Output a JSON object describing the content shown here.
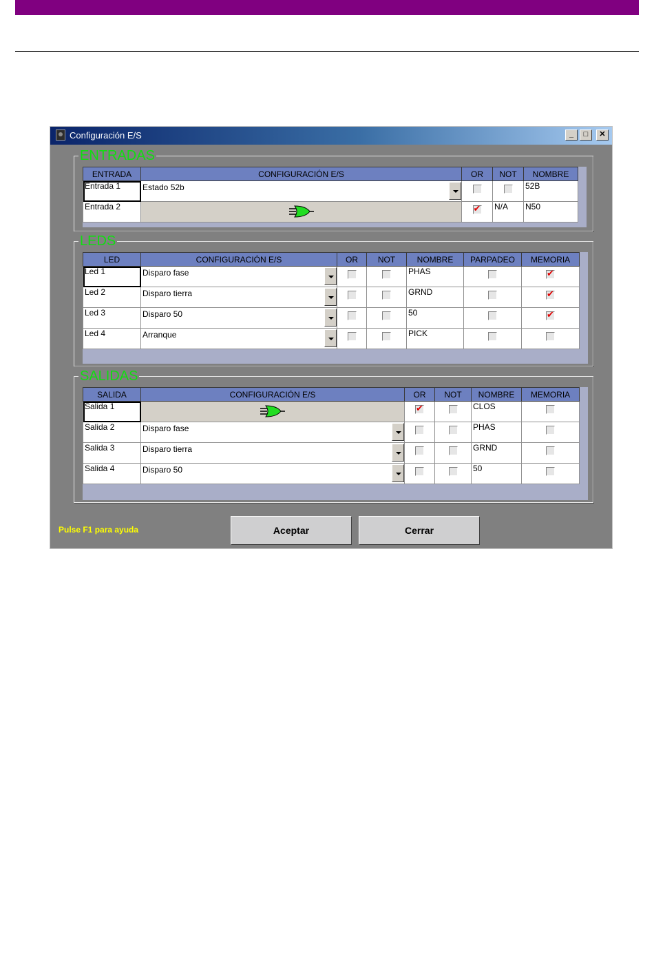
{
  "window": {
    "title": "Configuración E/S"
  },
  "entradas": {
    "legend": "ENTRADAS",
    "headers": [
      "ENTRADA",
      "CONFIGURACIÓN E/S",
      "OR",
      "NOT",
      "NOMBRE"
    ],
    "rows": [
      {
        "label": "Entrada 1",
        "config": "Estado 52b",
        "or": false,
        "not": false,
        "not_text": "",
        "name": "52B",
        "gate": false
      },
      {
        "label": "Entrada 2",
        "config": "",
        "or": true,
        "not": null,
        "not_text": "N/A",
        "name": "N50",
        "gate": true
      }
    ]
  },
  "leds": {
    "legend": "LEDS",
    "headers": [
      "LED",
      "CONFIGURACIÓN E/S",
      "OR",
      "NOT",
      "NOMBRE",
      "PARPADEO",
      "MEMORIA"
    ],
    "rows": [
      {
        "label": "Led 1",
        "config": "Disparo fase",
        "or": false,
        "not": false,
        "name": "PHAS",
        "parpadeo": false,
        "memoria": true
      },
      {
        "label": "Led 2",
        "config": "Disparo tierra",
        "or": false,
        "not": false,
        "name": "GRND",
        "parpadeo": false,
        "memoria": true
      },
      {
        "label": "Led 3",
        "config": "Disparo 50",
        "or": false,
        "not": false,
        "name": "50",
        "parpadeo": false,
        "memoria": true
      },
      {
        "label": "Led 4",
        "config": "Arranque",
        "or": false,
        "not": false,
        "name": "PICK",
        "parpadeo": false,
        "memoria": false
      }
    ]
  },
  "salidas": {
    "legend": "SALIDAS",
    "headers": [
      "SALIDA",
      "CONFIGURACIÓN E/S",
      "OR",
      "NOT",
      "NOMBRE",
      "MEMORIA"
    ],
    "rows": [
      {
        "label": "Salida 1",
        "config": "",
        "or": true,
        "not": false,
        "name": "CLOS",
        "memoria": false,
        "gate": true
      },
      {
        "label": "Salida 2",
        "config": "Disparo fase",
        "or": false,
        "not": false,
        "name": "PHAS",
        "memoria": false,
        "gate": false
      },
      {
        "label": "Salida 3",
        "config": "Disparo tierra",
        "or": false,
        "not": false,
        "name": "GRND",
        "memoria": false,
        "gate": false
      },
      {
        "label": "Salida 4",
        "config": "Disparo 50",
        "or": false,
        "not": false,
        "name": "50",
        "memoria": false,
        "gate": false
      }
    ]
  },
  "footer": {
    "help": "Pulse F1 para ayuda",
    "accept": "Aceptar",
    "close": "Cerrar"
  },
  "colors": {
    "legend": "#11dd11",
    "header": "#6d80c0",
    "check": "#e00000",
    "help": "#ffff00",
    "gate": "#22dd22"
  }
}
